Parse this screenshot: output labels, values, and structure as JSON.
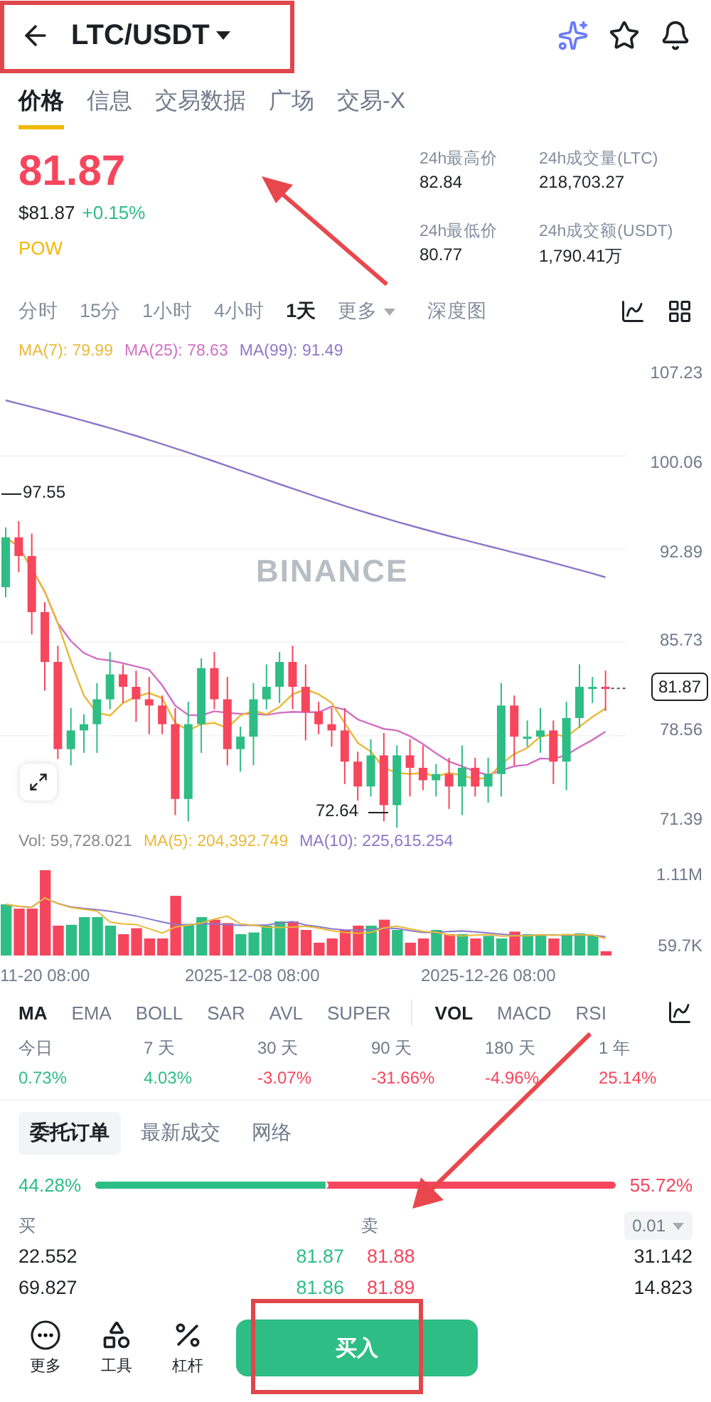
{
  "header": {
    "title": "LTC/USDT"
  },
  "tabs": [
    {
      "label": "价格",
      "selected": true
    },
    {
      "label": "信息",
      "selected": false
    },
    {
      "label": "交易数据",
      "selected": false
    },
    {
      "label": "广场",
      "selected": false
    },
    {
      "label": "交易-X",
      "selected": false
    }
  ],
  "price": {
    "last": "81.87",
    "fiat": "$81.87",
    "change": "+0.15%",
    "tag": "POW"
  },
  "stats": [
    {
      "label": "24h最高价",
      "value": "82.84"
    },
    {
      "label": "24h成交量(LTC)",
      "value": "218,703.27"
    },
    {
      "label": "24h最低价",
      "value": "80.77"
    },
    {
      "label": "24h成交额(USDT)",
      "value": "1,790.41万"
    }
  ],
  "intervals": [
    {
      "label": "分时",
      "selected": false,
      "kind": "plain"
    },
    {
      "label": "15分",
      "selected": false,
      "kind": "plain"
    },
    {
      "label": "1小时",
      "selected": false,
      "kind": "plain"
    },
    {
      "label": "4小时",
      "selected": false,
      "kind": "plain"
    },
    {
      "label": "1天",
      "selected": true,
      "kind": "plain"
    },
    {
      "label": "更多",
      "selected": false,
      "kind": "dropdown"
    },
    {
      "label": "深度图",
      "selected": false,
      "kind": "plain"
    }
  ],
  "chart": {
    "legend": [
      {
        "label": "MA(7): 79.99",
        "color": "#e8b93a"
      },
      {
        "label": "MA(25): 78.63",
        "color": "#d16fc4"
      },
      {
        "label": "MA(99): 91.49",
        "color": "#8a78c8"
      }
    ],
    "y_labels": [
      "107.23",
      "100.06",
      "92.89",
      "85.73",
      "78.56",
      "71.39"
    ],
    "last_price": "81.87",
    "high_marker": "97.55",
    "low_marker": "72.64",
    "watermark": "BINANCE"
  },
  "volume": {
    "legend": [
      {
        "label": "Vol: 59,728.021",
        "color": "#8a8a8a"
      },
      {
        "label": "MA(5): 204,392.749",
        "color": "#e8b93a"
      },
      {
        "label": "MA(10): 225,615.254",
        "color": "#8a78c8"
      }
    ],
    "y_labels": [
      "1.11M",
      "59.7K"
    ],
    "dates": [
      "11-20 08:00",
      "2025-12-08 08:00",
      "2025-12-26 08:00"
    ]
  },
  "indicators": {
    "main": [
      {
        "label": "MA",
        "selected": true
      },
      {
        "label": "EMA",
        "selected": false
      },
      {
        "label": "BOLL",
        "selected": false
      },
      {
        "label": "SAR",
        "selected": false
      },
      {
        "label": "AVL",
        "selected": false
      },
      {
        "label": "SUPER",
        "selected": false
      }
    ],
    "sub": [
      {
        "label": "VOL",
        "selected": true
      },
      {
        "label": "MACD",
        "selected": false
      },
      {
        "label": "RSI",
        "selected": false
      }
    ]
  },
  "periods": [
    {
      "label": "今日",
      "value": "0.73%",
      "color": "#2ebd85"
    },
    {
      "label": "7 天",
      "value": "4.03%",
      "color": "#2ebd85"
    },
    {
      "label": "30 天",
      "value": "-3.07%",
      "color": "#f6465d"
    },
    {
      "label": "90 天",
      "value": "-31.66%",
      "color": "#f6465d"
    },
    {
      "label": "180 天",
      "value": "-4.96%",
      "color": "#f6465d"
    },
    {
      "label": "1 年",
      "value": "25.14%",
      "color": "#f6465d"
    }
  ],
  "orderbook": {
    "tabs": [
      {
        "label": "委托订单",
        "selected": true
      },
      {
        "label": "最新成交",
        "selected": false
      },
      {
        "label": "网络",
        "selected": false
      }
    ],
    "buy_ratio": "44.28%",
    "sell_ratio": "55.72%",
    "level": 0.4428,
    "buy_label": "买",
    "sell_label": "卖",
    "precision": "0.01",
    "rows": [
      {
        "bid_qty": "22.552",
        "bid": "81.87",
        "ask": "81.88",
        "ask_qty": "31.142"
      },
      {
        "bid_qty": "69.827",
        "bid": "81.86",
        "ask": "81.89",
        "ask_qty": "14.823"
      }
    ]
  },
  "bottom_bar": {
    "actions": [
      {
        "label": "更多"
      },
      {
        "label": "工具"
      },
      {
        "label": "杠杆"
      }
    ],
    "buy": "买入"
  }
}
